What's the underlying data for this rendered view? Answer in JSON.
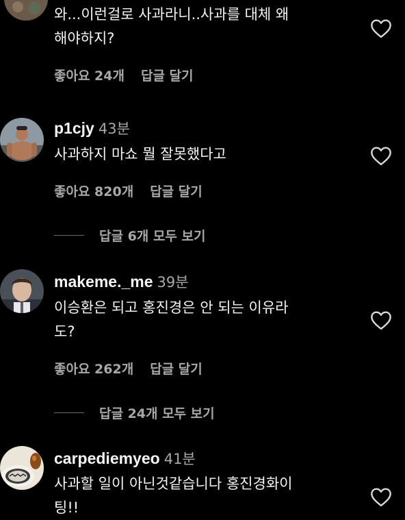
{
  "comments": [
    {
      "username": "",
      "time": "",
      "text_lines": [
        "와...이런걸로 사과라니..사과를 대체 왜",
        "해야하지?"
      ],
      "likes_label": "좋아요 24개",
      "reply_label": "답글 달기",
      "view_replies_label": ""
    },
    {
      "username": "p1cjy",
      "time": "43분",
      "text_lines": [
        "사과하지 마쇼 뭘 잘못했다고"
      ],
      "likes_label": "좋아요 820개",
      "reply_label": "답글 달기",
      "view_replies_label": "답글 6개 모두 보기"
    },
    {
      "username": "makeme._me",
      "time": "39분",
      "text_lines": [
        "이승환은 되고 홍진경은 안 되는 이유라",
        "도?"
      ],
      "likes_label": "좋아요 262개",
      "reply_label": "답글 달기",
      "view_replies_label": "답글 24개 모두 보기"
    },
    {
      "username": "carpediemyeo",
      "time": "41분",
      "text_lines": [
        "사과할 일이 아닌것같습니다 홍진경화이",
        "팅!!"
      ],
      "likes_label": "",
      "reply_label": "",
      "view_replies_label": ""
    }
  ],
  "icons": {
    "heart": "heart-outline-icon"
  },
  "colors": {
    "background": "#000000",
    "primary_text": "#f5f5f5",
    "secondary_text": "#a8a8a8"
  }
}
